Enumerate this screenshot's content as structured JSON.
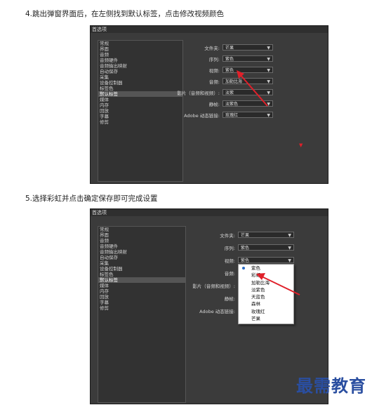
{
  "steps": [
    {
      "text": "4.跳出弹窗界面后，在左侧找到默认标签，点击修改视频颜色"
    },
    {
      "text": "5.选择彩虹并点击确定保存即可完成设置"
    }
  ],
  "shot1": {
    "title": "首选项",
    "sidebar": [
      "常规",
      "界面",
      "音频",
      "音频硬件",
      "音频输出映射",
      "自动保存",
      "采集",
      "设备控制器",
      "标签色",
      "默认标签",
      "媒体",
      "内存",
      "回放",
      "字幕",
      "修剪"
    ],
    "selected_index": 9,
    "fields": [
      {
        "label": "文件夹:",
        "value": "芒果"
      },
      {
        "label": "序列:",
        "value": "紫色"
      },
      {
        "label": "视频:",
        "value": "紫色"
      },
      {
        "label": "音频:",
        "value": "加勒比海"
      },
      {
        "label": "影片（音频和视频）:",
        "value": "淡紫"
      },
      {
        "label": "静帧:",
        "value": "淡紫色"
      },
      {
        "label": "Adobe 动态链接:",
        "value": "玫瑰红"
      }
    ]
  },
  "shot2": {
    "title": "首选项",
    "sidebar": [
      "常规",
      "界面",
      "音频",
      "音频硬件",
      "音频输出映射",
      "自动保存",
      "采集",
      "设备控制器",
      "标签色",
      "默认标签",
      "媒体",
      "内存",
      "回放",
      "字幕",
      "修剪"
    ],
    "selected_index": 9,
    "fields": [
      {
        "label": "文件夹:",
        "value": "芒果"
      },
      {
        "label": "序列:",
        "value": "紫色"
      },
      {
        "label": "视频:",
        "value": "紫色"
      },
      {
        "label": "音频:",
        "value": ""
      },
      {
        "label": "影片（音频和视频）:",
        "value": ""
      },
      {
        "label": "静帧:",
        "value": ""
      },
      {
        "label": "Adobe 动态链接:",
        "value": ""
      }
    ],
    "menu": [
      "紫色",
      "彩虹",
      "加勒比海",
      "淡紫色",
      "天蓝色",
      "森林",
      "玫瑰红",
      "芒果"
    ],
    "menu_checked_index": 0
  },
  "watermark": "最需教育",
  "colors": {
    "arrow": "#e0202a",
    "watermark": "#2a4ea0",
    "panel": "#3b3b3b"
  }
}
